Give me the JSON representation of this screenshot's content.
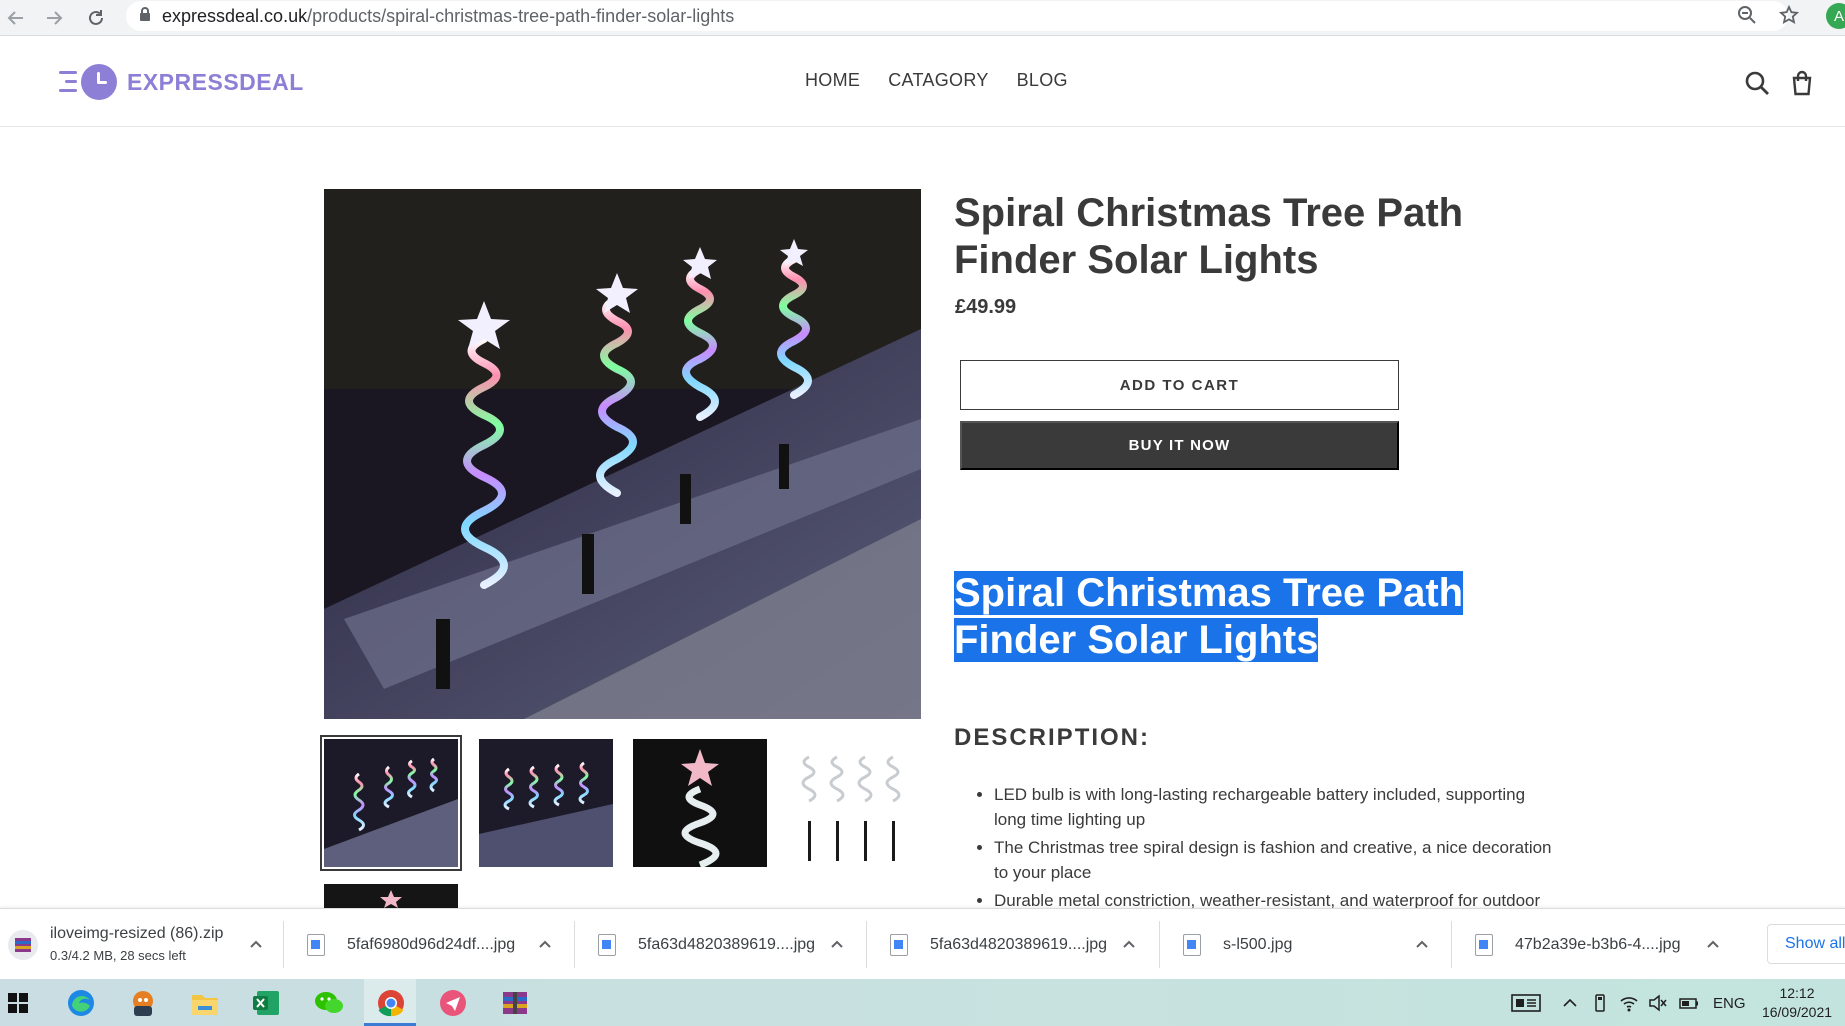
{
  "browser": {
    "url_domain": "expressdeal.co.uk",
    "url_path": "/products/spiral-christmas-tree-path-finder-solar-lights",
    "profile_initial": "A"
  },
  "site": {
    "brand": "EXPRESSDEAL",
    "nav": [
      "HOME",
      "CATAGORY",
      "BLOG"
    ]
  },
  "product": {
    "title": "Spiral Christmas Tree Path Finder Solar Lights",
    "price": "£49.99",
    "add_to_cart": "ADD TO CART",
    "buy_now": "BUY IT NOW",
    "desc_heading_line1": "Spiral Christmas Tree Path ",
    "desc_heading_line2": "Finder Solar Lights",
    "description_label": "DESCRIPTION:",
    "bullets": [
      "LED bulb is with long-lasting rechargeable battery included, supporting long time lighting up",
      "The Christmas tree spiral design is fashion and creative, a nice decoration to your place",
      "Durable metal constriction, weather-resistant, and waterproof for outdoor"
    ]
  },
  "downloads": {
    "items": [
      {
        "name": "iloveimg-resized (86).zip",
        "status": "0.3/4.2 MB, 28 secs left"
      },
      {
        "name": "5faf6980d96d24df....jpg"
      },
      {
        "name": "5fa63d4820389619....jpg"
      },
      {
        "name": "5fa63d4820389619....jpg"
      },
      {
        "name": "s-l500.jpg"
      },
      {
        "name": "47b2a39e-b3b6-4....jpg"
      }
    ],
    "show_all": "Show all"
  },
  "taskbar": {
    "lang": "ENG",
    "time": "12:12",
    "date": "16/09/2021"
  },
  "colors": {
    "brand": "#8e7fd6",
    "text": "#3a3a3a",
    "selection": "#1a73e8"
  }
}
